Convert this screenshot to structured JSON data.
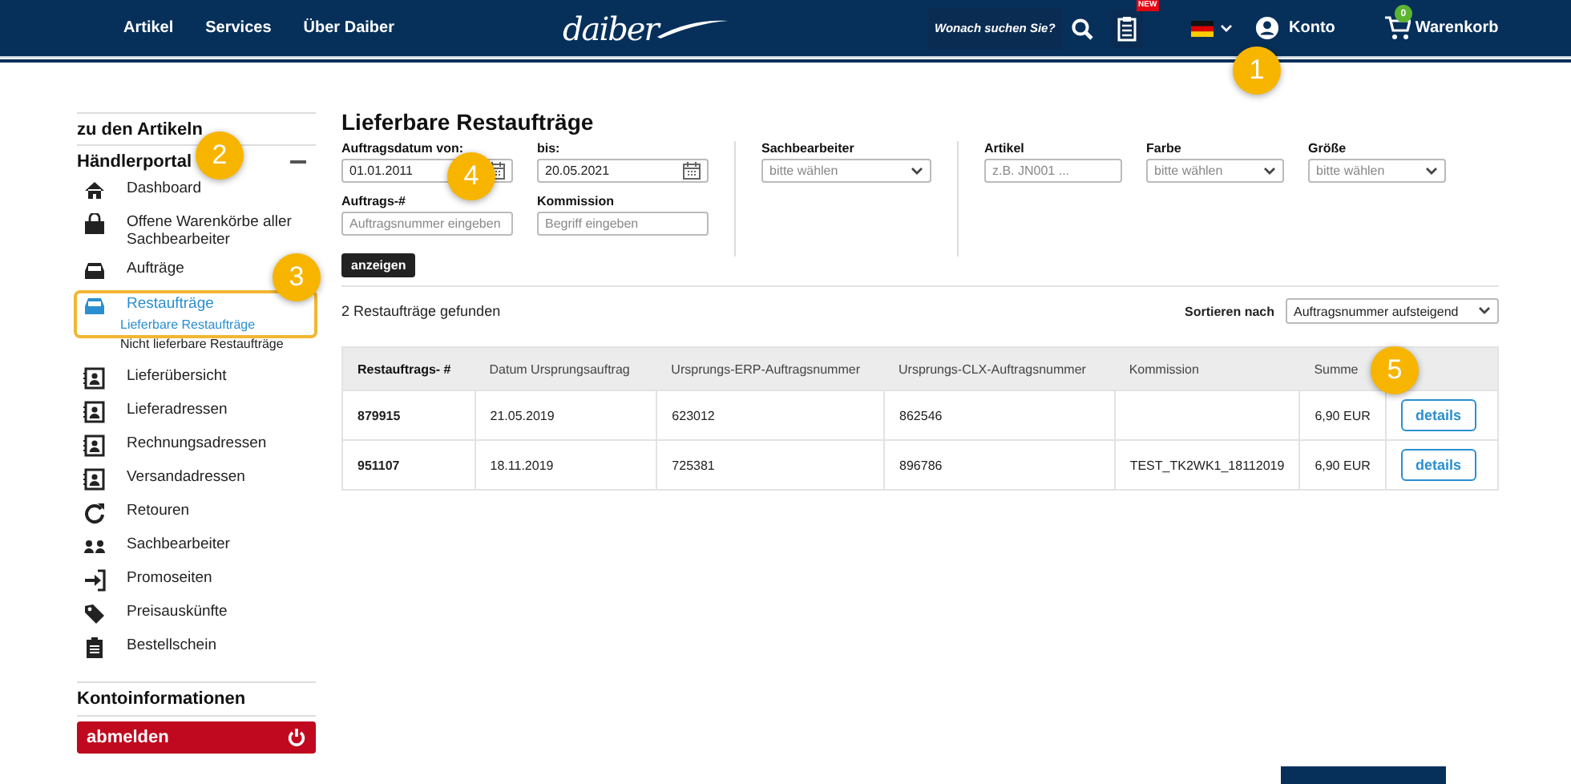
{
  "header": {
    "nav_links": [
      "Artikel",
      "Services",
      "Über Daiber"
    ],
    "logo": "daiber",
    "search": {
      "placeholder": "Wonach suchen Sie?"
    },
    "new_badge": "NEW",
    "account": "Konto",
    "cart_count": "0",
    "cart": "Warenkorb"
  },
  "sidebar": {
    "back_link": "zu den Artikeln",
    "section": "Händlerportal",
    "expanded": true,
    "items": [
      {
        "label": "Dashboard",
        "selected": false,
        "highlighted": false
      },
      {
        "label": "Offene Warenkörbe aller Sachbearbeiter",
        "selected": false,
        "highlighted": false
      },
      {
        "label": "Aufträge",
        "selected": false,
        "highlighted": false
      },
      {
        "label": "Restaufträge",
        "selected": true,
        "highlighted": true,
        "children": [
          {
            "label": "Lieferbare Restaufträge",
            "selected": true
          },
          {
            "label": "Nicht lieferbare Restaufträge",
            "selected": false
          }
        ]
      },
      {
        "label": "Lieferübersicht",
        "selected": false,
        "highlighted": false
      },
      {
        "label": "Lieferadressen",
        "selected": false,
        "highlighted": false
      },
      {
        "label": "Rechnungsadressen",
        "selected": false,
        "highlighted": false
      },
      {
        "label": "Versandadressen",
        "selected": false,
        "highlighted": false
      },
      {
        "label": "Retouren",
        "selected": false,
        "highlighted": false
      },
      {
        "label": "Sachbearbeiter",
        "selected": false,
        "highlighted": false
      },
      {
        "label": "Promoseiten",
        "selected": false,
        "highlighted": false
      },
      {
        "label": "Preisauskünfte",
        "selected": false,
        "highlighted": false
      },
      {
        "label": "Bestellschein",
        "selected": false,
        "highlighted": false
      }
    ],
    "account_section": "Kontoinformationen",
    "logout": "abmelden"
  },
  "main": {
    "title": "Lieferbare Restaufträge",
    "filter_groups": [
      {
        "columns": [
          [
            {
              "kind": "date",
              "label": "Auftragsdatum von:",
              "value": "01.01.2011"
            },
            {
              "kind": "text",
              "label": "Auftrags-#",
              "placeholder": "Auftragsnummer eingeben"
            }
          ],
          [
            {
              "kind": "date",
              "label": "bis:",
              "value": "20.05.2021"
            },
            {
              "kind": "text",
              "label": "Kommission",
              "placeholder": "Begriff eingeben"
            }
          ]
        ]
      },
      {
        "columns": [
          [
            {
              "kind": "select",
              "label": "Sachbearbeiter",
              "value": "bitte wählen"
            }
          ]
        ]
      },
      {
        "columns": [
          [
            {
              "kind": "text",
              "label": "Artikel",
              "placeholder": "z.B. JN001 ..."
            }
          ],
          [
            {
              "kind": "select",
              "label": "Farbe",
              "value": "bitte wählen"
            }
          ],
          [
            {
              "kind": "select",
              "label": "Größe",
              "value": "bitte wählen"
            }
          ]
        ]
      }
    ],
    "submit": "anzeigen",
    "result_count": "2 Restaufträge gefunden",
    "sort": {
      "label": "Sortieren nach",
      "value": "Auftragsnummer aufsteigend"
    },
    "table": {
      "columns": [
        "Restauftrags- #",
        "Datum Ursprungsauftrag",
        "Ursprungs-ERP-Auftragsnummer",
        "Ursprungs-CLX-Auftragsnummer",
        "Kommission",
        "Summe"
      ],
      "rows": [
        {
          "cells": [
            "879915",
            "21.05.2019",
            "623012",
            "862546",
            "",
            "6,90 EUR"
          ],
          "action": "details"
        },
        {
          "cells": [
            "951107",
            "18.11.2019",
            "725381",
            "896786",
            "TEST_TK2WK1_18112019",
            "6,90 EUR"
          ],
          "action": "details"
        }
      ]
    }
  },
  "callouts": [
    "1",
    "2",
    "3",
    "4",
    "5"
  ]
}
